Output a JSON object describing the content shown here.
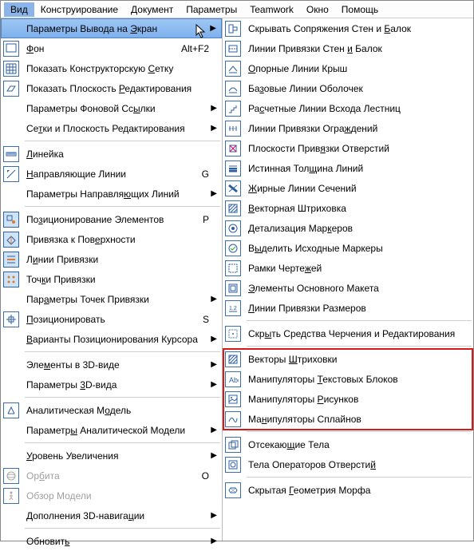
{
  "menubar": {
    "items": [
      {
        "label": "Вид",
        "active": true
      },
      {
        "label": "Конструирование"
      },
      {
        "label": "Документ"
      },
      {
        "label": "Параметры"
      },
      {
        "label": "Teamwork"
      },
      {
        "label": "Окно"
      },
      {
        "label": "Помощь"
      }
    ]
  },
  "left": {
    "items": [
      {
        "label": "Параметры Вывода на Экран",
        "icon": "",
        "sub": true,
        "selected": true
      },
      {
        "label": "Фон",
        "icon": "bg-icon",
        "shortcut": "Alt+F2"
      },
      {
        "label": "Показать Конструкторскую Сетку",
        "icon": "grid-icon"
      },
      {
        "label": "Показать Плоскость Редактирования",
        "icon": "editplane-icon"
      },
      {
        "label": "Параметры Фоновой Ссылки",
        "icon": "",
        "sub": true
      },
      {
        "label": "Сетки и Плоскость Редактирования",
        "icon": "",
        "sub": true
      },
      {
        "sep": true
      },
      {
        "label": "Линейка",
        "icon": "ruler-icon"
      },
      {
        "label": "Направляющие Линии",
        "icon": "guide-icon",
        "shortcut": "G"
      },
      {
        "label": "Параметры Направляющих Линий",
        "icon": "",
        "sub": true
      },
      {
        "sep": true
      },
      {
        "label": "Позиционирование Элементов",
        "icon": "snapel-icon",
        "pressed": true,
        "shortcut": "P"
      },
      {
        "label": "Привязка к Поверхности",
        "icon": "surface-icon",
        "pressed": true
      },
      {
        "label": "Линии Привязки",
        "icon": "snaplines-icon",
        "pressed": true
      },
      {
        "label": "Точки Привязки",
        "icon": "snappts-icon",
        "pressed": true
      },
      {
        "label": "Параметры Точек Привязки",
        "icon": "",
        "sub": true
      },
      {
        "label": "Позиционировать",
        "icon": "position-icon",
        "shortcut": "S"
      },
      {
        "label": "Варианты Позиционирования Курсора",
        "icon": "",
        "sub": true
      },
      {
        "sep": true
      },
      {
        "label": "Элементы в 3D-виде",
        "icon": "",
        "sub": true
      },
      {
        "label": "Параметры 3D-вида",
        "icon": "",
        "sub": true
      },
      {
        "sep": true
      },
      {
        "label": "Аналитическая Модель",
        "icon": "model-icon"
      },
      {
        "label": "Параметры Аналитической Модели",
        "icon": "",
        "sub": true
      },
      {
        "sep": true
      },
      {
        "label": "Уровень Увеличения",
        "icon": "",
        "sub": true
      },
      {
        "label": "Орбита",
        "icon": "orbit-icon",
        "shortcut": "O",
        "disabled": true
      },
      {
        "label": "Обзор Модели",
        "icon": "walk-icon",
        "disabled": true
      },
      {
        "label": "Дополнения 3D-навигации",
        "icon": "",
        "sub": true
      },
      {
        "sep": true
      },
      {
        "label": "Обновить",
        "icon": "",
        "sub": true
      }
    ]
  },
  "right": {
    "items": [
      {
        "label": "Скрывать Сопряжения Стен и Балок",
        "icon": "hide-join-icon"
      },
      {
        "label": "Линии Привязки Стен и Балок",
        "icon": "walllines-icon"
      },
      {
        "label": "Опорные Линии Крыш",
        "icon": "rooflines-icon"
      },
      {
        "label": "Базовые Линии Оболочек",
        "icon": "shelllines-icon"
      },
      {
        "label": "Расчетные Линии Всхода Лестниц",
        "icon": "stairlines-icon"
      },
      {
        "label": "Линии Привязки Ограждений",
        "icon": "raillines-icon"
      },
      {
        "label": "Плоскости Привязки Отверстий",
        "icon": "holeplanes-icon"
      },
      {
        "label": "Истинная Толщина Линий",
        "icon": "linewt-icon"
      },
      {
        "label": "Жирные Линии Сечений",
        "icon": "bold-section-icon"
      },
      {
        "label": "Векторная Штриховка",
        "icon": "vecthatch-icon"
      },
      {
        "label": "Детализация Маркеров",
        "icon": "markerdet-icon"
      },
      {
        "label": "Выделить Исходные Маркеры",
        "icon": "srcmarkers-icon"
      },
      {
        "label": "Рамки Чертежей",
        "icon": "drawframes-icon"
      },
      {
        "label": "Элементы Основного Макета",
        "icon": "layoutel-icon"
      },
      {
        "label": "Линии Привязки Размеров",
        "icon": "dimlines-icon"
      },
      {
        "sep": true
      },
      {
        "label": "Скрыть Средства Черчения и Редактирования",
        "icon": "hideedit-icon"
      },
      {
        "sep": true
      },
      {
        "label": "Векторы Штриховки",
        "icon": "hatchvec-icon",
        "hl": true
      },
      {
        "label": "Манипуляторы Текстовых Блоков",
        "icon": "texthandles-icon",
        "hl": true
      },
      {
        "label": "Манипуляторы Рисунков",
        "icon": "pichandles-icon",
        "hl": true
      },
      {
        "label": "Манипуляторы Сплайнов",
        "icon": "splinehandles-icon",
        "hl": true
      },
      {
        "sep": true
      },
      {
        "label": "Отсекающие Тела",
        "icon": "clipbodies-icon"
      },
      {
        "label": "Тела Операторов Отверстий",
        "icon": "holeops-icon"
      },
      {
        "sep": true
      },
      {
        "label": "Скрытая Геометрия Морфа",
        "icon": "morphgeo-icon"
      }
    ]
  }
}
